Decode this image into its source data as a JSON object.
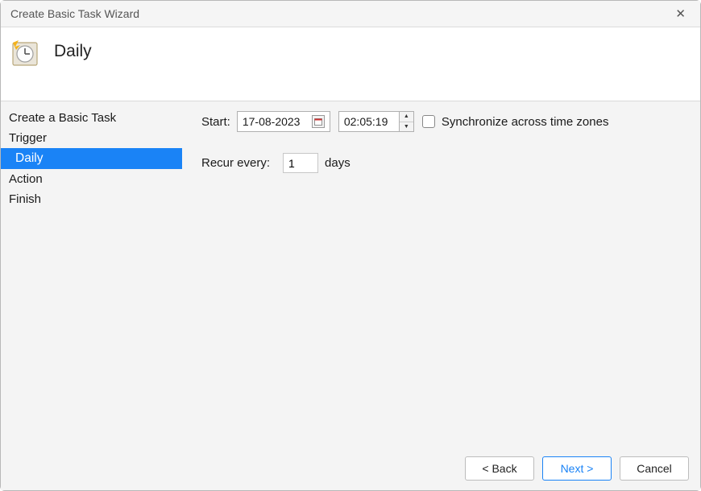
{
  "window": {
    "title": "Create Basic Task Wizard"
  },
  "header": {
    "title": "Daily"
  },
  "sidebar": {
    "items": [
      {
        "label": "Create a Basic Task",
        "selected": false,
        "indent": false
      },
      {
        "label": "Trigger",
        "selected": false,
        "indent": false
      },
      {
        "label": "Daily",
        "selected": true,
        "indent": true
      },
      {
        "label": "Action",
        "selected": false,
        "indent": false
      },
      {
        "label": "Finish",
        "selected": false,
        "indent": false
      }
    ]
  },
  "content": {
    "start_label": "Start:",
    "start_date": "17-08-2023",
    "start_time": "02:05:19",
    "sync_label": "Synchronize across time zones",
    "sync_checked": false,
    "recur_label": "Recur every:",
    "recur_value": "1",
    "recur_unit": "days"
  },
  "footer": {
    "back": "< Back",
    "next": "Next >",
    "cancel": "Cancel"
  }
}
